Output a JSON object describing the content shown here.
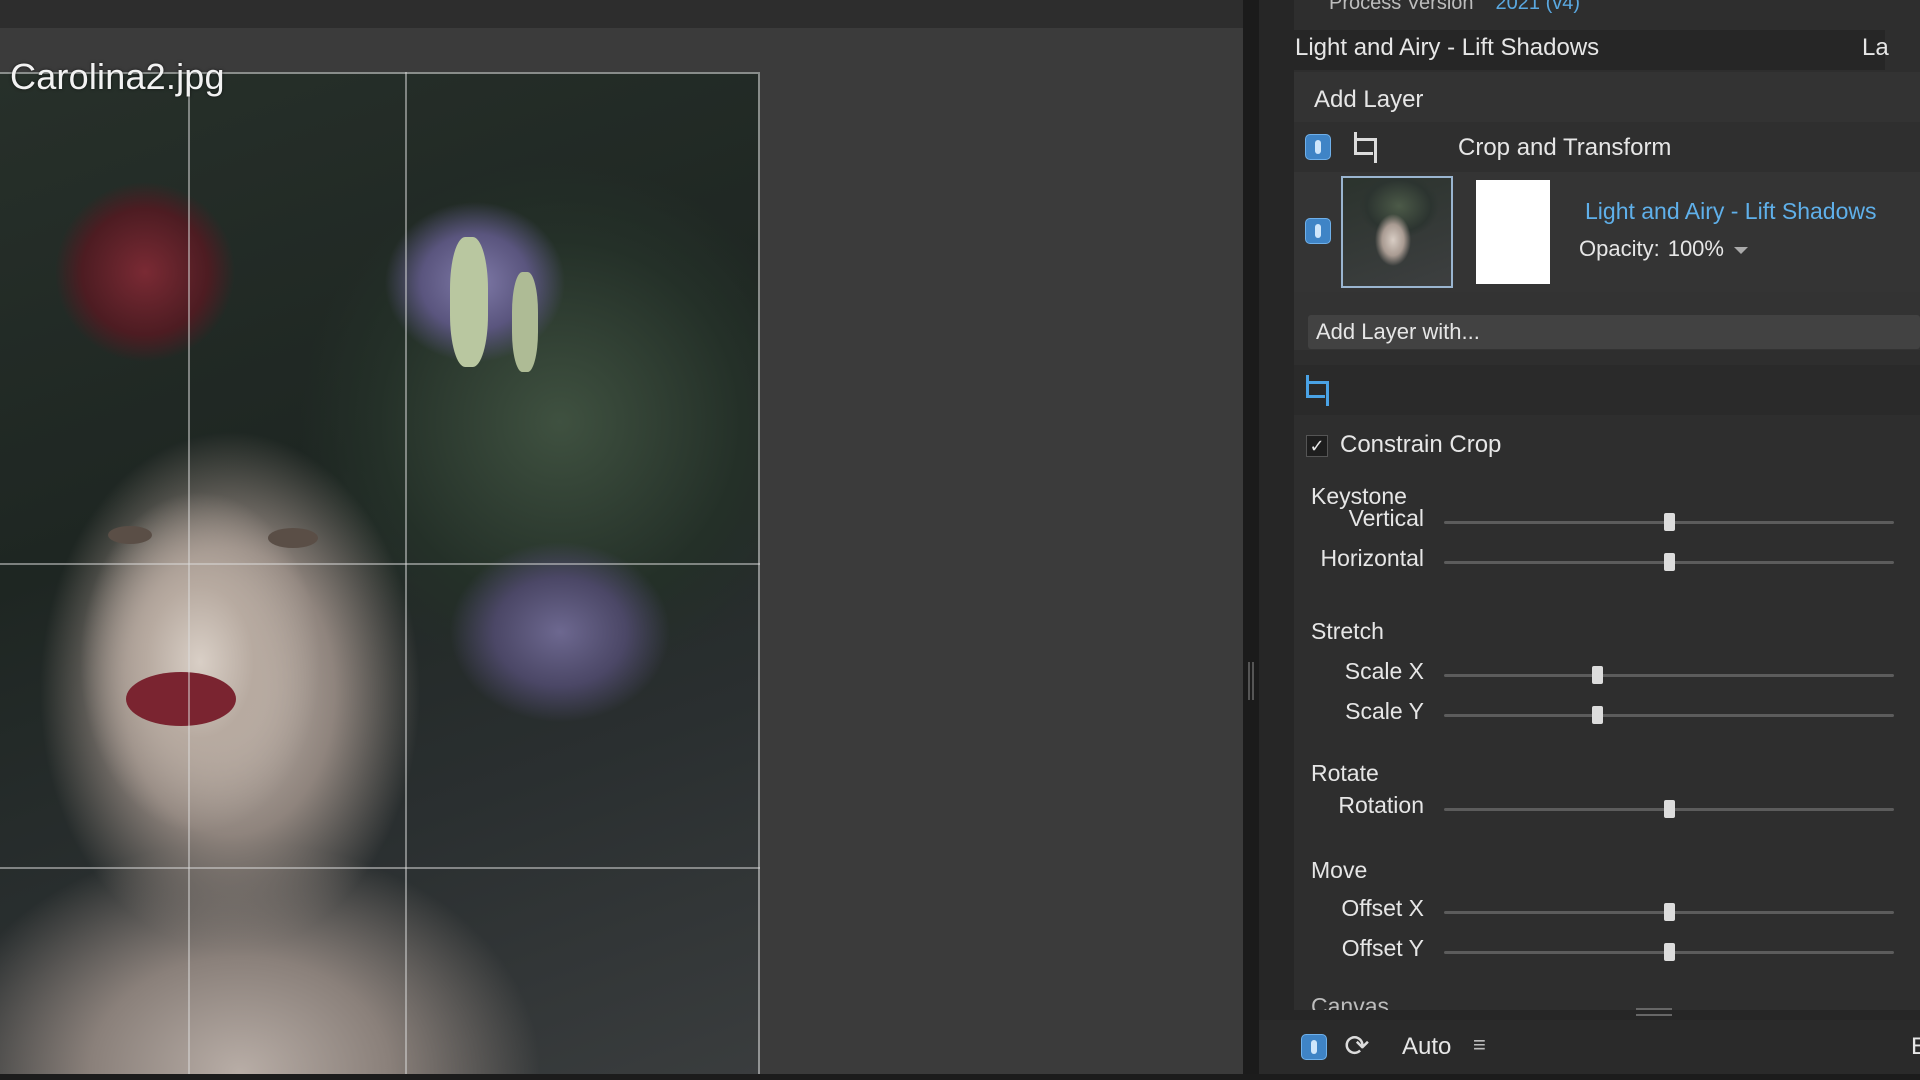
{
  "viewer": {
    "filename": "Carolina2.jpg"
  },
  "panel": {
    "process_label": "Process Version",
    "process_value": "2021 (v4)",
    "preset_title": "Light and Airy - Lift Shadows",
    "preset_tab_peek": "La"
  },
  "layers": {
    "add_layer": "Add Layer",
    "crop_layer_label": "Crop and Transform",
    "preset_layer_name": "Light and Airy - Lift Shadows",
    "opacity_label": "Opacity:",
    "opacity_value": "100%",
    "add_layer_with": "Add Layer with..."
  },
  "controls": {
    "constrain_crop_label": "Constrain Crop",
    "constrain_crop_checked": true,
    "check_mark": "✓",
    "groups": {
      "keystone": "Keystone",
      "stretch": "Stretch",
      "rotate": "Rotate",
      "move": "Move",
      "canvas_peek": "Canvas"
    },
    "sliders": [
      {
        "id": "vertical",
        "label": "Vertical",
        "value": 0.5
      },
      {
        "id": "horizontal",
        "label": "Horizontal",
        "value": 0.5
      },
      {
        "id": "scale-x",
        "label": "Scale X",
        "value": 0.34
      },
      {
        "id": "scale-y",
        "label": "Scale Y",
        "value": 0.34
      },
      {
        "id": "rotation",
        "label": "Rotation",
        "value": 0.5
      },
      {
        "id": "offset-x",
        "label": "Offset X",
        "value": 0.5
      },
      {
        "id": "offset-y",
        "label": "Offset Y",
        "value": 0.5
      }
    ]
  },
  "footer": {
    "auto_label": "Auto",
    "edge_peek": "E"
  },
  "colors": {
    "accent": "#4aa3e6",
    "link": "#5fb0ea"
  }
}
